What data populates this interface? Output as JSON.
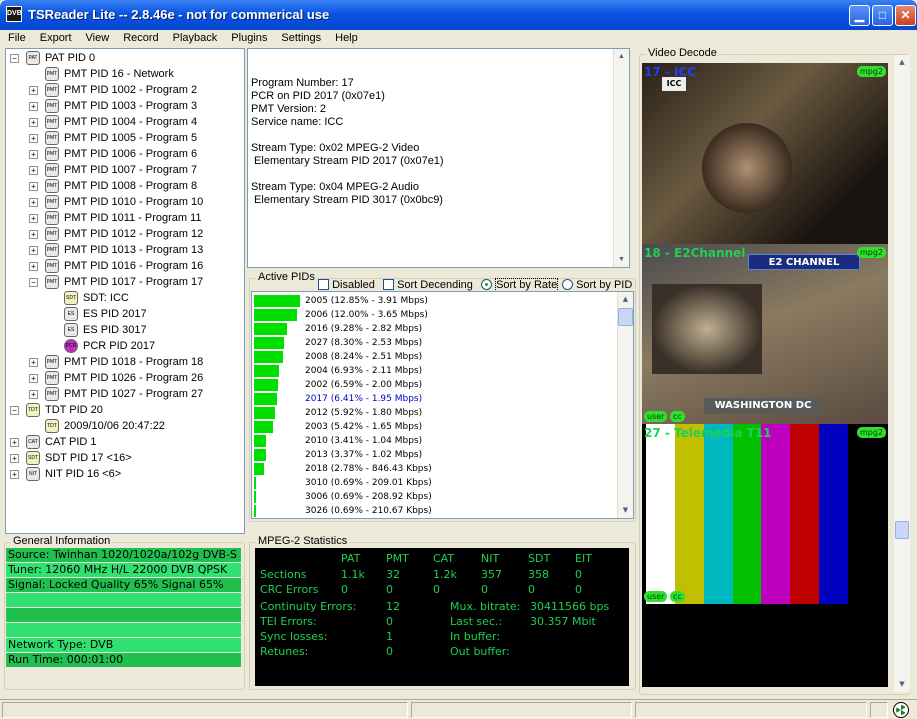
{
  "window": {
    "title": "TSReader Lite -- 2.8.46e - not for commerical use",
    "app_icon": "DVB"
  },
  "menu": [
    "File",
    "Export",
    "View",
    "Record",
    "Playback",
    "Plugins",
    "Settings",
    "Help"
  ],
  "tree": [
    {
      "label": "PAT PID 0",
      "icon": "PAT",
      "exp": "−"
    },
    {
      "label": "PMT PID 16 - Network",
      "icon": "PMT"
    },
    {
      "label": "PMT PID 1002 - Program 2",
      "icon": "PMT",
      "exp": "+"
    },
    {
      "label": "PMT PID 1003 - Program 3",
      "icon": "PMT",
      "exp": "+"
    },
    {
      "label": "PMT PID 1004 - Program 4",
      "icon": "PMT",
      "exp": "+"
    },
    {
      "label": "PMT PID 1005 - Program 5",
      "icon": "PMT",
      "exp": "+"
    },
    {
      "label": "PMT PID 1006 - Program 6",
      "icon": "PMT",
      "exp": "+"
    },
    {
      "label": "PMT PID 1007 - Program 7",
      "icon": "PMT",
      "exp": "+"
    },
    {
      "label": "PMT PID 1008 - Program 8",
      "icon": "PMT",
      "exp": "+"
    },
    {
      "label": "PMT PID 1010 - Program 10",
      "icon": "PMT",
      "exp": "+"
    },
    {
      "label": "PMT PID 1011 - Program 11",
      "icon": "PMT",
      "exp": "+"
    },
    {
      "label": "PMT PID 1012 - Program 12",
      "icon": "PMT",
      "exp": "+"
    },
    {
      "label": "PMT PID 1013 - Program 13",
      "icon": "PMT",
      "exp": "+"
    },
    {
      "label": "PMT PID 1016 - Program 16",
      "icon": "PMT",
      "exp": "+"
    },
    {
      "label": "PMT PID 1017 - Program 17",
      "icon": "PMT",
      "exp": "−"
    },
    {
      "label": "SDT: ICC",
      "icon": "SDT"
    },
    {
      "label": "ES PID 2017",
      "icon": "ES"
    },
    {
      "label": "ES PID 3017",
      "icon": "ES"
    },
    {
      "label": "PCR PID 2017",
      "icon": "PCR"
    },
    {
      "label": "PMT PID 1018 - Program 18",
      "icon": "PMT",
      "exp": "+"
    },
    {
      "label": "PMT PID 1026 - Program 26",
      "icon": "PMT",
      "exp": "+"
    },
    {
      "label": "PMT PID 1027 - Program 27",
      "icon": "PMT",
      "exp": "+"
    },
    {
      "label": "TDT PID 20",
      "icon": "TDT",
      "exp": "−"
    },
    {
      "label": "2009/10/06 20:47:22",
      "icon": "TDT"
    },
    {
      "label": "CAT PID 1",
      "icon": "CAT",
      "exp": "+"
    },
    {
      "label": "SDT PID 17 <16>",
      "icon": "SDT",
      "exp": "+"
    },
    {
      "label": "NIT PID 16 <6>",
      "icon": "NIT",
      "exp": "+"
    }
  ],
  "info_text": "Program Number: 17\nPCR on PID 2017 (0x07e1)\nPMT Version: 2\nService name: ICC\n\nStream Type: 0x02 MPEG-2 Video\n Elementary Stream PID 2017 (0x07e1)\n\nStream Type: 0x04 MPEG-2 Audio\n Elementary Stream PID 3017 (0x0bc9)",
  "active_pids": {
    "title": "Active PIDs",
    "options": {
      "disabled": "Disabled",
      "sort_desc": "Sort Decending",
      "sort_rate": "Sort by Rate",
      "sort_pid": "Sort by PID"
    },
    "rows": [
      {
        "text": "2005 (12.85% - 3.91 Mbps)",
        "pct": 12.85
      },
      {
        "text": "2006 (12.00% - 3.65 Mbps)",
        "pct": 12.0
      },
      {
        "text": "2016 (9.28% - 2.82 Mbps)",
        "pct": 9.28
      },
      {
        "text": "2027 (8.30% - 2.53 Mbps)",
        "pct": 8.3
      },
      {
        "text": "2008 (8.24% - 2.51 Mbps)",
        "pct": 8.24
      },
      {
        "text": "2004 (6.93% - 2.11 Mbps)",
        "pct": 6.93
      },
      {
        "text": "2002 (6.59% - 2.00 Mbps)",
        "pct": 6.59
      },
      {
        "text": "2017 (6.41% - 1.95 Mbps)",
        "pct": 6.41,
        "sel": true
      },
      {
        "text": "2012 (5.92% - 1.80 Mbps)",
        "pct": 5.92
      },
      {
        "text": "2003 (5.42% - 1.65 Mbps)",
        "pct": 5.42
      },
      {
        "text": "2010 (3.41% - 1.04 Mbps)",
        "pct": 3.41
      },
      {
        "text": "2013 (3.37% - 1.02 Mbps)",
        "pct": 3.37
      },
      {
        "text": "2018 (2.78% - 846.43 Kbps)",
        "pct": 2.78
      },
      {
        "text": "3010 (0.69% - 209.01 Kbps)",
        "pct": 0.69
      },
      {
        "text": "3006 (0.69% - 208.92 Kbps)",
        "pct": 0.69
      },
      {
        "text": "3026 (0.69% - 210.67 Kbps)",
        "pct": 0.69
      }
    ]
  },
  "general_info": {
    "title": "General Information",
    "lines": [
      "Source: Twinhan 1020/1020a/102g DVB-S",
      "Tuner: 12060 MHz H/L 22000 DVB QPSK",
      "Signal: Locked Quality 65% Signal 65%",
      "",
      "",
      "",
      "Network Type: DVB",
      "Run Time: 000:01:00"
    ]
  },
  "stats": {
    "title": "MPEG-2 Statistics",
    "headers": [
      "PAT",
      "PMT",
      "CAT",
      "NIT",
      "SDT",
      "EIT"
    ],
    "sections_label": "Sections",
    "sections": [
      "1.1k",
      "32",
      "1.2k",
      "357",
      "358",
      "0"
    ],
    "crc_label": "CRC Errors",
    "crc": [
      "0",
      "0",
      "0",
      "0",
      "0",
      "0"
    ],
    "continuity_label": "Continuity Errors:",
    "continuity": "12",
    "tei_label": "TEI Errors:",
    "tei": "0",
    "sync_label": "Sync losses:",
    "sync": "1",
    "retunes_label": "Retunes:",
    "retunes": "0",
    "mux_label": "Mux. bitrate:",
    "mux": "30411566 bps",
    "last_label": "Last sec.:",
    "last": "30.357 Mbit",
    "inbuf_label": "In buffer:",
    "outbuf_label": "Out buffer:"
  },
  "video": {
    "title": "Video Decode",
    "channels": [
      {
        "label": "17 - ICC",
        "codec": "mpg2"
      },
      {
        "label": "18 - E2Channel",
        "codec": "mpg2",
        "overlay_top": "E2 CHANNEL",
        "overlay_bottom": "WASHINGTON DC",
        "badges": [
          "user",
          "cc"
        ]
      },
      {
        "label": "27 - Telemedia T11",
        "codec": "mpg2",
        "badges": [
          "user",
          "cc"
        ]
      }
    ]
  },
  "colors": {
    "bar": "#00e000",
    "stats_text": "#20d050",
    "selected_row": "#0000cc"
  }
}
